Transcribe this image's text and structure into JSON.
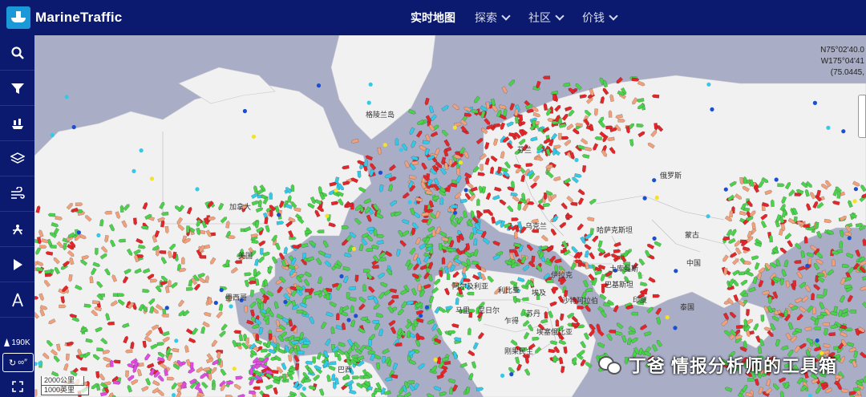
{
  "app": {
    "name": "MarineTraffic"
  },
  "nav": [
    {
      "label": "实时地图",
      "active": true,
      "dropdown": false
    },
    {
      "label": "探索",
      "active": false,
      "dropdown": true
    },
    {
      "label": "社区",
      "active": false,
      "dropdown": true
    },
    {
      "label": "价钱",
      "active": false,
      "dropdown": true
    }
  ],
  "sidebar": {
    "buttons": [
      {
        "icon": "search-icon"
      },
      {
        "icon": "filter-icon"
      },
      {
        "icon": "fleet-icon"
      },
      {
        "icon": "layers-icon"
      },
      {
        "icon": "wind-icon"
      },
      {
        "icon": "density-icon"
      },
      {
        "icon": "play-icon"
      },
      {
        "icon": "measure-icon"
      }
    ],
    "vessel_count": "190K",
    "toggle_label": "∞″"
  },
  "coords": {
    "lat": "N75°02'40.0",
    "lon": "W175°04'41",
    "decimal": "(75.0445,"
  },
  "scale": {
    "metric": "2000公里",
    "imperial": "1000英里"
  },
  "watermark": "丁爸 情报分析师的工具箱",
  "map_labels": [
    "格陵兰岛",
    "加拿大",
    "美国",
    "俄罗斯",
    "哈萨克斯坦",
    "蒙古",
    "中国",
    "乌克兰",
    "伊拉克",
    "土库曼斯",
    "巴基斯坦",
    "印度",
    "阿尔及利亚",
    "利比亚",
    "埃及",
    "马里",
    "尼日尔",
    "苏丹",
    "乍得",
    "埃塞俄比亚",
    "刚果民主",
    "巴西",
    "沙特阿拉伯",
    "芬兰",
    "泰国",
    "墨西哥"
  ],
  "colors": {
    "header_bg": "#0b1a6e",
    "cargo": "#4bd14b",
    "tanker": "#e2262a",
    "passenger": "#1b4fd1",
    "fishing": "#f0a07a",
    "pleasure": "#e04ce0",
    "highspeed": "#f4e12a",
    "unknown": "#35c9e8"
  }
}
